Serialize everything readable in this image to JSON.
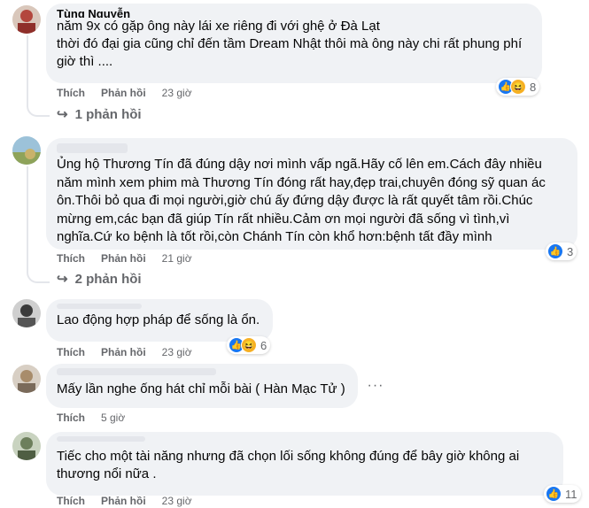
{
  "comments": [
    {
      "author": "Tùng Nguyễn",
      "text": "năm 9x có gặp ông này lái xe riêng đi với ghệ ở Đà Lạt\nthời đó đại gia cũng chỉ đến tầm Dream Nhật thôi mà ông này chi rất phung phí giờ thì ....",
      "like_label": "Thích",
      "reply_label": "Phản hồi",
      "time": "23 giờ",
      "reaction_count": "8",
      "reactions": [
        "like-icon",
        "haha-icon"
      ],
      "replies_label": "1 phản hồi"
    },
    {
      "author": "",
      "text": "Ủng hộ Thương Tín đã đúng dậy nơi mình vấp ngã.Hãy cố lên em.Cách đây nhiều năm mình xem phim mà Thương Tín đóng rất hay,đẹp trai,chuyên đóng sỹ quan ác ôn.Thôi bỏ qua đi mọi người,giờ chú ấy đứng dậy được là rất quyết tâm rồi.Chúc mừng em,các bạn đã giúp Tín rất nhiều.Cảm ơn mọi người đã sống vì tình,vì nghĩa.Cứ ko bệnh là tốt rồi,còn Chánh Tín còn khổ hơn:bệnh tất đầy mình",
      "like_label": "Thích",
      "reply_label": "Phản hồi",
      "time": "21 giờ",
      "reaction_count": "3",
      "reactions": [
        "like-icon"
      ],
      "replies_label": "2 phản hồi"
    },
    {
      "author": "",
      "text": "Lao động hợp pháp để sống là ổn.",
      "like_label": "Thích",
      "reply_label": "Phản hồi",
      "time": "23 giờ",
      "reaction_count": "6",
      "reactions": [
        "like-icon",
        "haha-icon"
      ]
    },
    {
      "author": "",
      "text": "Mấy lần nghe ống hát chỉ mỗi bài ( Hàn Mạc Tử )",
      "like_label": "Thích",
      "time": "5 giờ"
    },
    {
      "author": "",
      "text": "Tiếc cho một tài năng nhưng đã chọn lối sống không đúng để bây giờ không ai thương nổi nữa .",
      "like_label": "Thích",
      "reply_label": "Phản hồi",
      "time": "23 giờ",
      "reaction_count": "11",
      "reactions": [
        "like-icon"
      ]
    }
  ],
  "colors": {
    "bubble": "#f0f2f5",
    "secondary_text": "#65676b",
    "like_blue": "#1877f2",
    "haha_yellow": "#f7b125"
  }
}
